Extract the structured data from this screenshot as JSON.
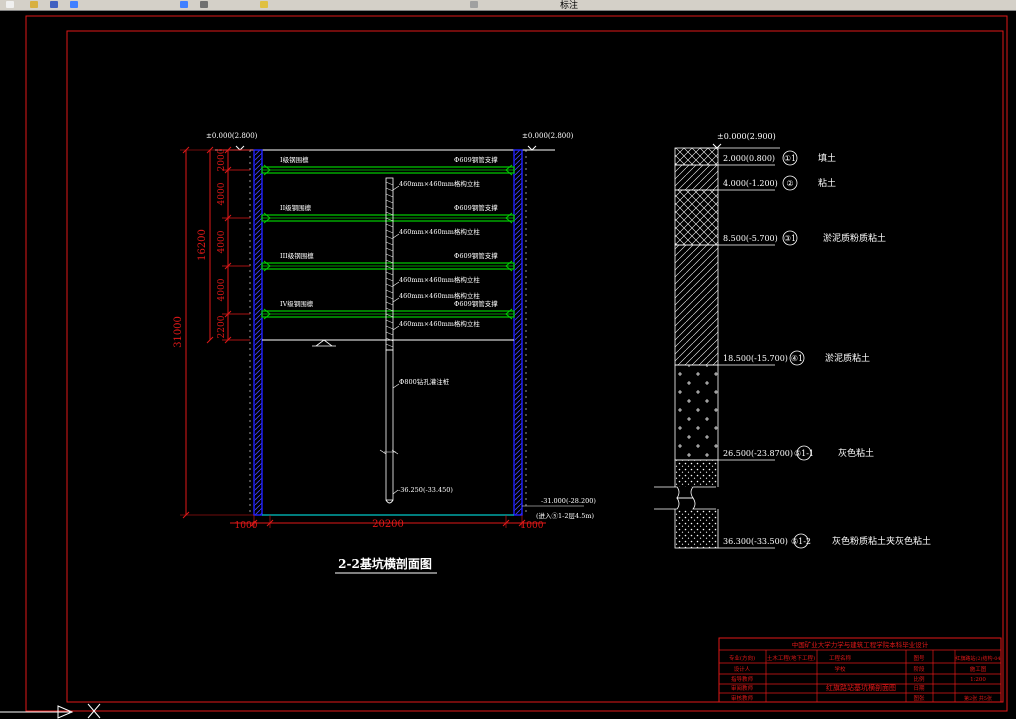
{
  "toolbar": {
    "icons": [
      "new-icon",
      "open-icon",
      "save-icon",
      "undo-icon",
      "redo-icon",
      "print-icon",
      "layer-icon",
      "properties-icon"
    ],
    "layer_field": "标注"
  },
  "section": {
    "title": "2-2基坑横剖面图",
    "ground_left": "±0.000(2.800)",
    "ground_right": "±0.000(2.800)",
    "dims_left": [
      "2000",
      "4000",
      "4000",
      "4000",
      "2200"
    ],
    "dim_excavation": "16200",
    "dim_total": "31000",
    "dim_side_left": "1000",
    "dim_width": "20200",
    "dim_side_right": "1000",
    "waling_labels": [
      "I级钢围檩",
      "II级钢围檩",
      "III级钢围檩",
      "IV级钢围檩"
    ],
    "strut_labels": [
      "Φ609钢管支撑",
      "Φ609钢管支撑",
      "Φ609钢管支撑",
      "Φ609钢管支撑"
    ],
    "column_labels": [
      "460mm×460mm格构立柱",
      "460mm×460mm格构立柱",
      "460mm×460mm格构立柱",
      "460mm×460mm格构立柱",
      "460mm×460mm格构立柱"
    ],
    "pile_label": "Φ800钻孔灌注桩",
    "pile_bottom": "-36.250(-33.450)",
    "wall_bottom": "-31.000(-28.200)",
    "wall_embed": "(进入⑤1-2层4.5m)"
  },
  "soil": {
    "top": "±0.000(2.900)",
    "layers": [
      {
        "depth": "2.000(0.800)",
        "symbol": "①1",
        "name": "填土"
      },
      {
        "depth": "4.000(-1.200)",
        "symbol": "②",
        "name": "粘土"
      },
      {
        "depth": "8.500(-5.700)",
        "symbol": "③1",
        "name": "淤泥质粉质粘土"
      },
      {
        "depth": "18.500(-15.700)",
        "symbol": "④1",
        "name": "淤泥质粘土"
      },
      {
        "depth": "26.500(-23.8700)",
        "symbol": "⑤1-1",
        "name": "灰色粘土"
      },
      {
        "depth": "36.300(-33.500)",
        "symbol": "⑤1-2",
        "name": "灰色粉质粘土夹灰色粘土"
      }
    ]
  },
  "title_block": {
    "header": "中国矿业大学力学与建筑工程学院本科毕业设计",
    "drawing_name": "红旗路站基坑横剖面图",
    "rows_left": [
      "专业(方向)",
      "设计人",
      "指导教师",
      "审阅教师",
      "审核教师"
    ],
    "field_major": "土木工程(地下工程)",
    "label_project": "工程名称",
    "label_school": "学校",
    "label_drawing_no": "图号",
    "drawing_no": "红旗路站(2)结构-04",
    "label_scale": "比例",
    "scale": "1:200",
    "label_date": "日期",
    "label_sheet": "图张",
    "sheet": "第2张 共5张",
    "label_stage": "阶段",
    "stage": "施工图"
  },
  "colors": {
    "frame": "#e01818",
    "dimension": "#e01818",
    "wall": "#2020ff",
    "strut": "#00d000",
    "text": "#ffffff",
    "background": "#000000",
    "floor": "#00c8c8"
  }
}
